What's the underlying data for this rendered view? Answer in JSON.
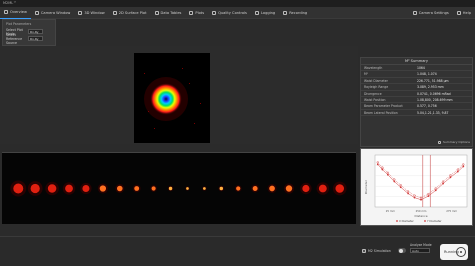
{
  "window": {
    "title": "M2ML™"
  },
  "toolbar": {
    "tabs": [
      {
        "label": "Overview",
        "icon": "overview-icon",
        "active": true
      },
      {
        "label": "Camera Window",
        "icon": "camera-icon"
      },
      {
        "label": "3D Window",
        "icon": "cube-icon"
      },
      {
        "label": "2D Surface Plot",
        "icon": "surface-plot-icon"
      },
      {
        "label": "Data Tables",
        "icon": "table-icon"
      },
      {
        "label": "Plots",
        "icon": "plot-icon"
      },
      {
        "label": "Quality Controls",
        "icon": "quality-icon"
      },
      {
        "label": "Logging",
        "icon": "logging-icon"
      },
      {
        "label": "Recording",
        "icon": "record-icon"
      }
    ],
    "right": [
      {
        "label": "Camera Settings",
        "icon": "gear-icon"
      },
      {
        "label": "Help",
        "icon": "help-icon"
      }
    ]
  },
  "params": {
    "header": "Plot Parameters",
    "rows": [
      {
        "label": "Select Plot Mode",
        "value": "Rx,Ry"
      },
      {
        "label": "Select Reference Source",
        "value": "Rx,Ry"
      }
    ]
  },
  "summary": {
    "title": "M² Summary",
    "rows": [
      {
        "k": "Wavelength",
        "v": "1064"
      },
      {
        "k": "M²",
        "v": "1.048, 1.074"
      },
      {
        "k": "Waist Diameter",
        "v": "226.771, 51.988 μm"
      },
      {
        "k": "Rayleigh Range",
        "v": "3.089, 2.953 mm"
      },
      {
        "k": "Divergence",
        "v": "0.0741, 0.0696 mRad"
      },
      {
        "k": "Waist Position",
        "v": "1.08,800, 208.699 mm"
      },
      {
        "k": "Beam Parameter Product",
        "v": "0.577, 0.756"
      },
      {
        "k": "Beam Lateral Position",
        "v": "5.04,1.21,1.33, 9.87"
      }
    ],
    "button": "Summary Options"
  },
  "chart_data": {
    "type": "scatter",
    "series": [
      {
        "name": "X Diameter",
        "color": "#d23a3a"
      },
      {
        "name": "Y Diameter",
        "color": "#d23a3a"
      }
    ],
    "ylabel": "Diameter",
    "xlabel": "Distance",
    "xticks": [
      "25 mm",
      "250 mm",
      "275 mm"
    ],
    "points": [
      [
        0.03,
        0.18
      ],
      [
        0.08,
        0.28
      ],
      [
        0.14,
        0.38
      ],
      [
        0.21,
        0.51
      ],
      [
        0.28,
        0.62
      ],
      [
        0.36,
        0.74
      ],
      [
        0.43,
        0.82
      ],
      [
        0.5,
        0.86
      ],
      [
        0.58,
        0.79
      ],
      [
        0.66,
        0.68
      ],
      [
        0.74,
        0.55
      ],
      [
        0.82,
        0.43
      ],
      [
        0.9,
        0.32
      ],
      [
        0.96,
        0.22
      ]
    ],
    "vlines": [
      0.52,
      0.6
    ]
  },
  "bottom": {
    "m2_label": "M2 Simulation",
    "mode_label": "Analyze Mode",
    "mode_value": "Auto",
    "run_label": "Running"
  }
}
